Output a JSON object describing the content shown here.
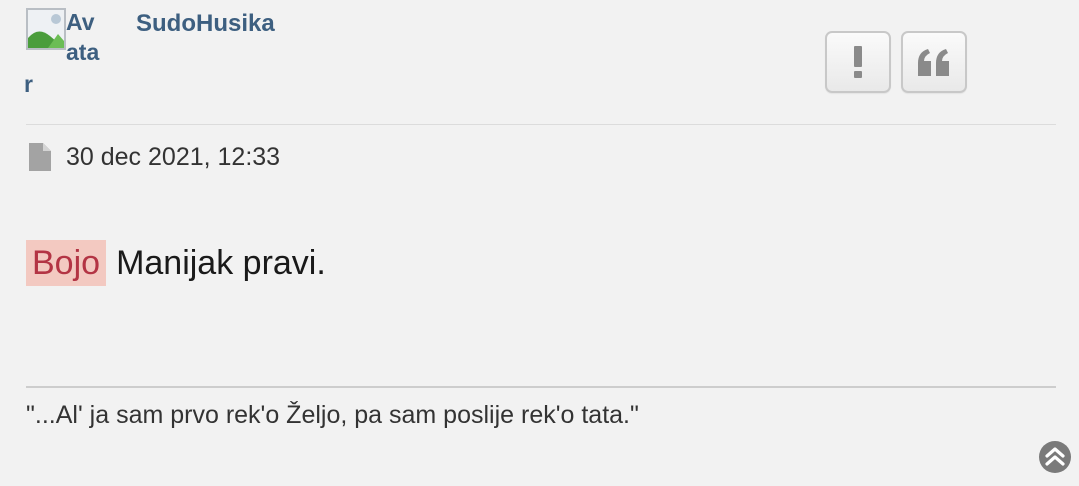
{
  "post": {
    "author": {
      "avatar_alt_lines": [
        "Av",
        "ata",
        "r"
      ],
      "username": "SudoHusika"
    },
    "actions": {
      "report_icon": "exclamation-icon",
      "quote_icon": "quote-icon"
    },
    "meta": {
      "icon": "file-icon",
      "date": "30 dec 2021, 12:33"
    },
    "content": {
      "mention": "Bojo",
      "text": "Manijak pravi."
    },
    "signature": "\"...Al' ja sam prvo rek'o Željo, pa sam poslije rek'o tata.\""
  },
  "nav": {
    "back_to_top_icon": "chevron-up-circle-icon"
  },
  "colors": {
    "background": "#f2f2f2",
    "username": "#3d5f80",
    "mention_bg": "#f3c9c1",
    "mention_text": "#b33444",
    "text": "#1a1a1a"
  }
}
